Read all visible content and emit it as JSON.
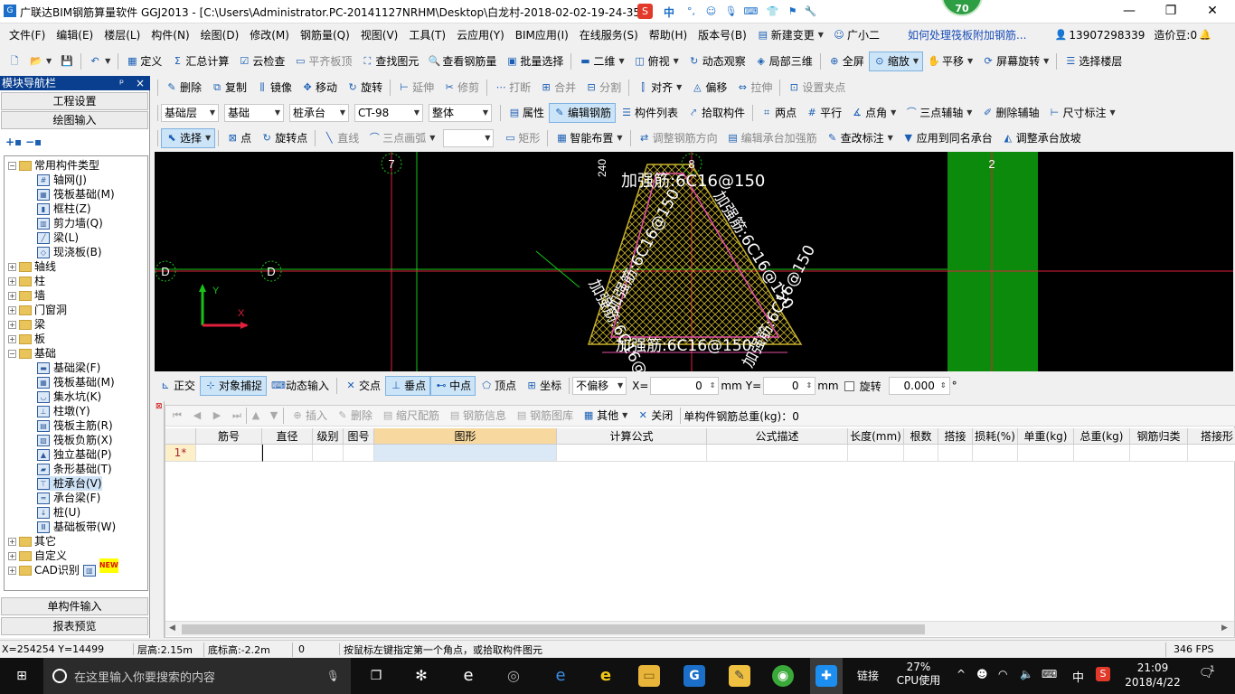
{
  "titlebar": {
    "title": "广联达BIM钢筋算量软件 GGJ2013 - [C:\\Users\\Administrator.PC-20141127NRHM\\Desktop\\白龙村-2018-02-02-19-24-35",
    "ime_label": "中",
    "badge_value": "70",
    "minimize": "—",
    "restore": "❐",
    "close": "✕"
  },
  "menu": {
    "items": [
      "文件(F)",
      "编辑(E)",
      "楼层(L)",
      "构件(N)",
      "绘图(D)",
      "修改(M)",
      "钢筋量(Q)",
      "视图(V)",
      "工具(T)",
      "云应用(Y)",
      "BIM应用(I)",
      "在线服务(S)",
      "帮助(H)",
      "版本号(B)"
    ],
    "new_change": "新建变更",
    "guangxiaoer": "广小二",
    "help_link": "如何处理筏板附加钢筋...",
    "phone": "13907298339",
    "zaojia": "造价豆:0"
  },
  "toolbar1": [
    "定义",
    "汇总计算",
    "云检查",
    "平齐板顶",
    "查找图元",
    "查看钢筋量",
    "批量选择",
    "二维",
    "俯视",
    "动态观察",
    "局部三维",
    "全屏",
    "缩放",
    "平移",
    "屏幕旋转",
    "选择楼层"
  ],
  "toolbar2": [
    "删除",
    "复制",
    "镜像",
    "移动",
    "旋转",
    "延伸",
    "修剪",
    "打断",
    "合并",
    "分割",
    "对齐",
    "偏移",
    "拉伸",
    "设置夹点"
  ],
  "toolbar3": {
    "combos": [
      "基础层",
      "基础",
      "桩承台",
      "CT-98",
      "整体"
    ],
    "buttons": [
      "属性",
      "编辑钢筋",
      "构件列表",
      "拾取构件",
      "两点",
      "平行",
      "点角",
      "三点辅轴",
      "删除辅轴",
      "尺寸标注"
    ]
  },
  "toolbar4": [
    "选择",
    "点",
    "旋转点",
    "直线",
    "三点画弧",
    "矩形",
    "智能布置",
    "调整钢筋方向",
    "编辑承台加强筋",
    "查改标注",
    "应用到同名承台",
    "调整承台放坡"
  ],
  "leftpanel": {
    "header": "模块导航栏",
    "pin": "ᵖ",
    "close": "×",
    "btn_project": "工程设置",
    "btn_drawing": "绘图输入",
    "btn_single": "单构件输入",
    "btn_report": "报表预览",
    "tree": {
      "common": "常用构件类型",
      "common_items": [
        "轴网(J)",
        "筏板基础(M)",
        "框柱(Z)",
        "剪力墙(Q)",
        "梁(L)",
        "现浇板(B)"
      ],
      "groups": [
        "轴线",
        "柱",
        "墙",
        "门窗洞",
        "梁",
        "板"
      ],
      "foundation": "基础",
      "foundation_items": [
        "基础梁(F)",
        "筏板基础(M)",
        "集水坑(K)",
        "柱墩(Y)",
        "筏板主筋(R)",
        "筏板负筋(X)",
        "独立基础(P)",
        "条形基础(T)",
        "桩承台(V)",
        "承台梁(F)",
        "桩(U)",
        "基础板带(W)"
      ],
      "others": [
        "其它",
        "自定义",
        "CAD识别"
      ],
      "new_badge": "NEW"
    }
  },
  "canvas": {
    "axis_7": "7",
    "axis_8": "8",
    "axis_2": "2",
    "axis_D1": "D",
    "axis_D2": "D",
    "dim_240": "240",
    "rebar_top": "加强筋:6C16@150",
    "rebar_left": "加强筋:6C16@150",
    "rebar_right": "加强筋:6C16@150",
    "rebar_bottom": "加强筋:6C16@150",
    "rebar_left2": "加强筋:6C16@150",
    "rebar_right2": "加强筋:6C16@150",
    "ucs_x": "X",
    "ucs_y": "Y",
    "colors": {
      "grid_line": "#e0203c",
      "green_line": "#19c219",
      "green_block": "#0b8a0b",
      "triangle": "#e64fa8",
      "hatch": "#c7b12a"
    }
  },
  "snapbar": {
    "buttons": [
      "正交",
      "对象捕捉",
      "动态输入",
      "交点",
      "垂点",
      "中点",
      "顶点",
      "坐标"
    ],
    "offset": "不偏移",
    "x_label": "X=",
    "x_value": "0",
    "y_label": "Y=",
    "y_value": "0",
    "unit": "mm",
    "rotate_label": "旋转",
    "rotate_value": "0.000",
    "deg": "°"
  },
  "grid": {
    "toolbar": [
      "插入",
      "删除",
      "缩尺配筋",
      "钢筋信息",
      "钢筋图库",
      "其他",
      "关闭"
    ],
    "total": "单构件钢筋总重(kg)：0",
    "columns": [
      "筋号",
      "直径(mm)",
      "级别",
      "图号",
      "图形",
      "计算公式",
      "公式描述",
      "长度(mm)",
      "根数",
      "搭接",
      "损耗(%)",
      "单重(kg)",
      "总重(kg)",
      "钢筋归类",
      "搭接形"
    ],
    "row1": "1*"
  },
  "status": {
    "coords": "X=254254 Y=14499",
    "floor_height": "层高:2.15m",
    "base_height": "底标高:-2.2m",
    "zero": "0",
    "hint": "按鼠标左键指定第一个角点，或拾取构件图元",
    "fps": "346 FPS"
  },
  "taskbar": {
    "search": "在这里输入你要搜索的内容",
    "link": "链接",
    "cpu_pct": "27%",
    "cpu_label": "CPU使用",
    "ime": "中",
    "time": "21:09",
    "date": "2018/4/22",
    "notif": "1"
  }
}
